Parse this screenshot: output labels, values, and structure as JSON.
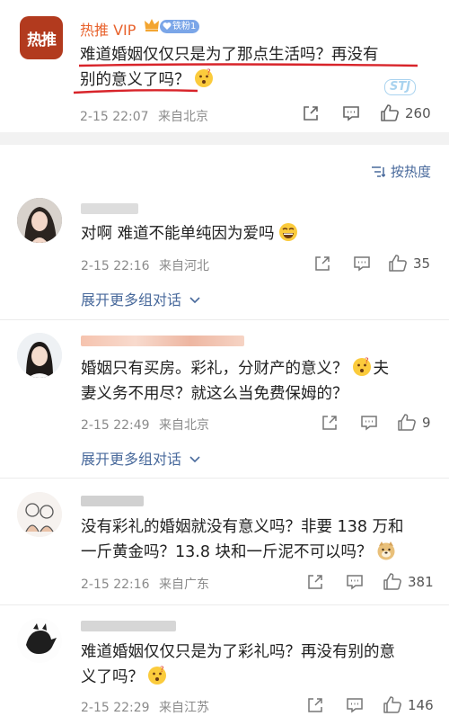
{
  "post": {
    "author": "热推 VIP",
    "badge": "铁粉1",
    "logo_text": "热推",
    "text_line1": "难道婚姻仅仅只是为了那点生活吗？再没有",
    "text_line2": "别的意义了吗？",
    "date": "2-15 22:07",
    "location": "来自北京",
    "likes": "260",
    "watermark": "STJ"
  },
  "sort": {
    "label": "按热度"
  },
  "comments": [
    {
      "text_lines": [
        "对啊 难道不能单纯因为爱吗"
      ],
      "date": "2-15 22:16",
      "location": "来自河北",
      "likes": "35",
      "expand": "展开更多组对话"
    },
    {
      "text_lines": [
        "婚姻只有买房。彩礼，分财产的意义？",
        "妻义务不用尽？就这么当免费保姆的？"
      ],
      "overflow_char": "夫",
      "date": "2-15 22:49",
      "location": "来自北京",
      "likes": "9",
      "expand": "展开更多组对话"
    },
    {
      "text_lines": [
        "没有彩礼的婚姻就没有意义吗？非要 138 万和",
        "一斤黄金吗？13.8 块和一斤泥不可以吗？"
      ],
      "date": "2-15 22:16",
      "location": "来自广东",
      "likes": "381"
    },
    {
      "text_lines": [
        "难道婚姻仅仅只是为了彩礼吗？再没有别的意",
        "义了吗？"
      ],
      "date": "2-15 22:29",
      "location": "来自江苏",
      "likes": "146"
    }
  ],
  "icons": [
    "share-icon",
    "comment-icon",
    "like-icon",
    "sort-icon",
    "chevron-down-icon"
  ],
  "colors": {
    "vip_name": "#e8622c",
    "link": "#496a9c",
    "underline": "#d8242a",
    "meta": "#8a8a8a"
  }
}
